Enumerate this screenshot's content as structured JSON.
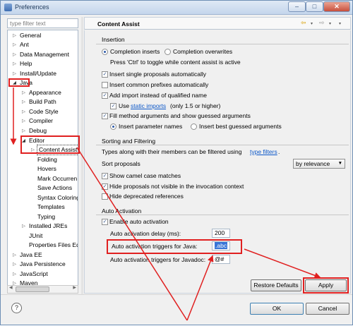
{
  "window": {
    "title": "Preferences",
    "min_symbol": "–",
    "max_symbol": "□",
    "close_symbol": "✕"
  },
  "left": {
    "filter_placeholder": "type filter text",
    "tree": [
      {
        "label": "General",
        "expanded": false
      },
      {
        "label": "Ant",
        "expanded": false
      },
      {
        "label": "Data Management",
        "expanded": false
      },
      {
        "label": "Help",
        "expanded": false
      },
      {
        "label": "Install/Update",
        "expanded": false
      },
      {
        "label": "Java",
        "expanded": true
      },
      {
        "label": "Appearance",
        "expanded": false
      },
      {
        "label": "Build Path",
        "expanded": false
      },
      {
        "label": "Code Style",
        "expanded": false
      },
      {
        "label": "Compiler",
        "expanded": false
      },
      {
        "label": "Debug",
        "expanded": false
      },
      {
        "label": "Editor",
        "expanded": true
      },
      {
        "label": "Content Assist",
        "expanded": false
      },
      {
        "label": "Folding"
      },
      {
        "label": "Hovers"
      },
      {
        "label": "Mark Occurren"
      },
      {
        "label": "Save Actions"
      },
      {
        "label": "Syntax Coloring"
      },
      {
        "label": "Templates"
      },
      {
        "label": "Typing"
      },
      {
        "label": "Installed JREs",
        "expanded": false
      },
      {
        "label": "JUnit"
      },
      {
        "label": "Properties Files Ed"
      },
      {
        "label": "Java EE",
        "expanded": false
      },
      {
        "label": "Java Persistence",
        "expanded": false
      },
      {
        "label": "JavaScript",
        "expanded": false
      },
      {
        "label": "Maven",
        "expanded": false
      }
    ]
  },
  "right": {
    "title": "Content Assist",
    "insertion": {
      "heading": "Insertion",
      "completion_inserts": "Completion inserts",
      "completion_overwrites": "Completion overwrites",
      "toggle_hint": "Press 'Ctrl' to toggle while content assist is active",
      "insert_single": "Insert single proposals automatically",
      "insert_common": "Insert common prefixes automatically",
      "add_import": "Add import instead of qualified name",
      "use_prefix": "Use",
      "static_imports": "static imports",
      "use_suffix": "(only 1.5 or higher)",
      "fill_method": "Fill method arguments and show guessed arguments",
      "insert_param_names": "Insert parameter names",
      "insert_best_guessed": "Insert best guessed arguments"
    },
    "sorting": {
      "heading": "Sorting and Filtering",
      "types_prefix": "Types along with their members can be filtered using",
      "type_filters": "type filters",
      "types_suffix": ".",
      "sort_proposals": "Sort proposals",
      "sort_value": "by relevance",
      "show_camel": "Show camel case matches",
      "hide_invisible": "Hide proposals not visible in the invocation context",
      "hide_deprecated": "Hide deprecated references"
    },
    "activation": {
      "heading": "Auto Activation",
      "enable": "Enable auto activation",
      "delay_label": "Auto activation delay (ms):",
      "delay_value": "200",
      "java_label": "Auto activation triggers for Java:",
      "java_value": ".abc",
      "javadoc_label": "Auto activation triggers for Javadoc:",
      "javadoc_value": "@#"
    },
    "restore_defaults": "Restore Defaults",
    "apply": "Apply"
  },
  "footer": {
    "help_symbol": "?",
    "ok": "OK",
    "cancel": "Cancel"
  },
  "colors": {
    "annotation_red": "#e02020",
    "link_blue": "#0b57c8",
    "selection_blue": "#3875d7"
  }
}
